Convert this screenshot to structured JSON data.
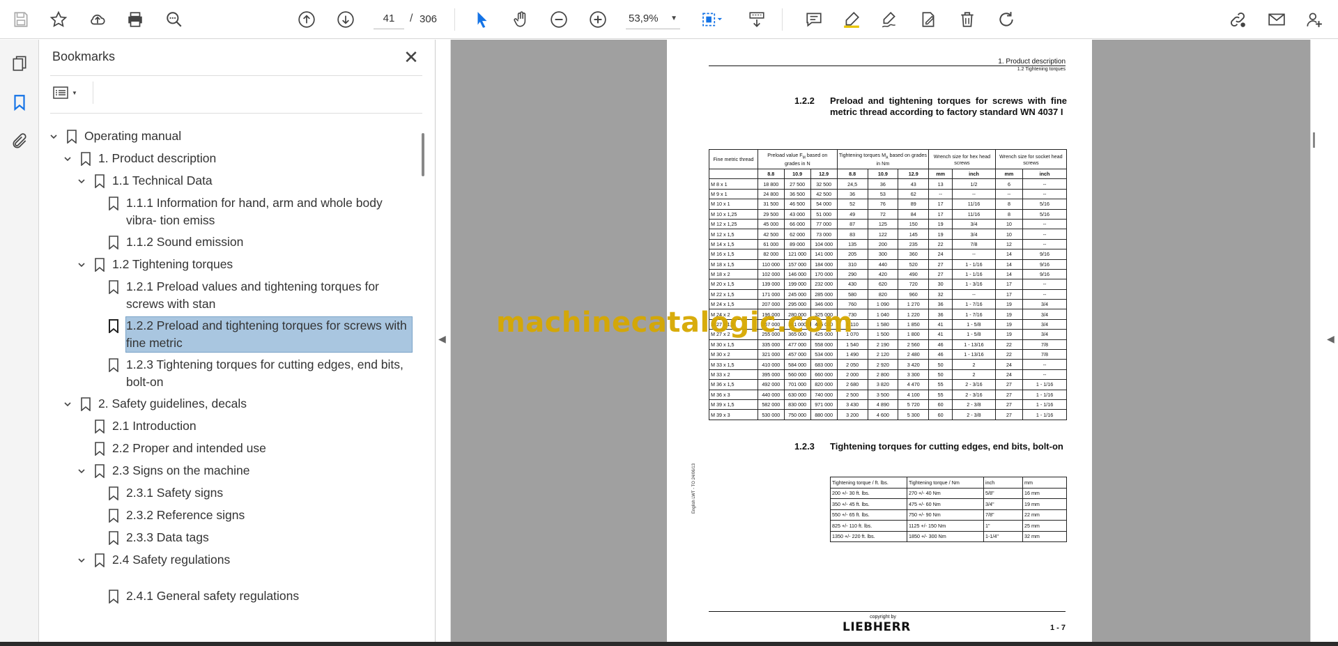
{
  "toolbar": {
    "page_current": "41",
    "page_separator": "/",
    "page_total": "306",
    "zoom": "53,9%"
  },
  "bookmarks_panel": {
    "title": "Bookmarks",
    "items": [
      {
        "label": "Operating manual",
        "expanded": true
      },
      {
        "label": "1. Product description",
        "expanded": true
      },
      {
        "label": "1.1 Technical Data",
        "expanded": true
      },
      {
        "label": "1.1.1 Information for hand, arm and whole body vibra- tion emiss"
      },
      {
        "label": "1.1.2 Sound emission"
      },
      {
        "label": "1.2 Tightening torques",
        "expanded": true
      },
      {
        "label": "1.2.1 Preload values and tightening torques for screws with stan"
      },
      {
        "label": "1.2.2 Preload and tightening torques for screws with fine metric",
        "selected": true
      },
      {
        "label": "1.2.3 Tightening torques for cutting edges, end bits, bolt-on"
      },
      {
        "label": "2. Safety guidelines, decals",
        "expanded": true
      },
      {
        "label": "2.1 Introduction"
      },
      {
        "label": "2.2 Proper and intended use"
      },
      {
        "label": "2.3 Signs on the machine",
        "expanded": true
      },
      {
        "label": "2.3.1 Safety signs"
      },
      {
        "label": "2.3.2 Reference signs"
      },
      {
        "label": "2.3.3 Data tags"
      },
      {
        "label": "2.4 Safety regulations",
        "expanded": true
      },
      {
        "label": "2.4.1 General safety regulations"
      }
    ]
  },
  "document": {
    "header_chapter": "1. Product description",
    "header_section": "1.2 Tightening torques",
    "section1_num": "1.2.2",
    "section1_title": "Preload and tightening torques for screws with fine metric thread according to factory standard WN 4037 I",
    "table1": {
      "headers": [
        "Fine metric thread",
        "Preload value F",
        "M",
        " based on grades in N",
        "Tightening torques M",
        "A",
        " based on grades in Nm",
        "Wrench size for hex head screws",
        "Wrench size for socket head screws"
      ],
      "subheaders": [
        "8.8",
        "10.9",
        "12.9",
        "8.8",
        "10.9",
        "12.9",
        "mm",
        "inch",
        "mm",
        "inch"
      ],
      "rows": [
        [
          "M 8 x 1",
          "18 800",
          "27 500",
          "32 500",
          "24,5",
          "36",
          "43",
          "13",
          "1/2",
          "6",
          "--"
        ],
        [
          "M 9 x 1",
          "24 800",
          "36 500",
          "42 500",
          "36",
          "53",
          "62",
          "--",
          "--",
          "--",
          "--"
        ],
        [
          "M 10 x 1",
          "31 500",
          "46 500",
          "54 000",
          "52",
          "76",
          "89",
          "17",
          "11/16",
          "8",
          "5/16"
        ],
        [
          "M 10 x 1,25",
          "29 500",
          "43 000",
          "51 000",
          "49",
          "72",
          "84",
          "17",
          "11/16",
          "8",
          "5/16"
        ],
        [
          "M 12 x 1,25",
          "45 000",
          "66 000",
          "77 000",
          "87",
          "125",
          "150",
          "19",
          "3/4",
          "10",
          "--"
        ],
        [
          "M 12 x 1,5",
          "42 500",
          "62 000",
          "73 000",
          "83",
          "122",
          "145",
          "19",
          "3/4",
          "10",
          "--"
        ],
        [
          "M 14 x 1,5",
          "61 000",
          "89 000",
          "104 000",
          "135",
          "200",
          "235",
          "22",
          "7/8",
          "12",
          "--"
        ],
        [
          "M 16 x 1,5",
          "82 000",
          "121 000",
          "141 000",
          "205",
          "300",
          "360",
          "24",
          "--",
          "14",
          "9/16"
        ],
        [
          "M 18 x 1,5",
          "110 000",
          "157 000",
          "184 000",
          "310",
          "440",
          "520",
          "27",
          "1 - 1/16",
          "14",
          "9/16"
        ],
        [
          "M 18 x 2",
          "102 000",
          "146 000",
          "170 000",
          "290",
          "420",
          "490",
          "27",
          "1 - 1/16",
          "14",
          "9/16"
        ],
        [
          "M 20 x 1,5",
          "139 000",
          "199 000",
          "232 000",
          "430",
          "620",
          "720",
          "30",
          "1 - 3/16",
          "17",
          "--"
        ],
        [
          "M 22 x 1,5",
          "171 000",
          "245 000",
          "285 000",
          "580",
          "820",
          "960",
          "32",
          "--",
          "17",
          "--"
        ],
        [
          "M 24 x 1,5",
          "207 000",
          "295 000",
          "346 000",
          "760",
          "1 090",
          "1 270",
          "36",
          "1 - 7/16",
          "19",
          "3/4"
        ],
        [
          "M 24 x 2",
          "196 000",
          "280 000",
          "325 000",
          "730",
          "1 040",
          "1 220",
          "36",
          "1 - 7/16",
          "19",
          "3/4"
        ],
        [
          "M 27 x 1,5",
          "267 000",
          "381 000",
          "445 000",
          "1 110",
          "1 580",
          "1 850",
          "41",
          "1 - 5/8",
          "19",
          "3/4"
        ],
        [
          "M 27 x 2",
          "255 000",
          "365 000",
          "425 000",
          "1 070",
          "1 500",
          "1 800",
          "41",
          "1 - 5/8",
          "19",
          "3/4"
        ],
        [
          "M 30 x 1,5",
          "335 000",
          "477 000",
          "558 000",
          "1 540",
          "2 190",
          "2 560",
          "46",
          "1 - 13/16",
          "22",
          "7/8"
        ],
        [
          "M 30 x 2",
          "321 000",
          "457 000",
          "534 000",
          "1 490",
          "2 120",
          "2 480",
          "46",
          "1 - 13/16",
          "22",
          "7/8"
        ],
        [
          "M 33 x 1,5",
          "410 000",
          "584 000",
          "683 000",
          "2 050",
          "2 920",
          "3 420",
          "50",
          "2",
          "24",
          "--"
        ],
        [
          "M 33 x 2",
          "395 000",
          "560 000",
          "660 000",
          "2 000",
          "2 800",
          "3 300",
          "50",
          "2",
          "24",
          "--"
        ],
        [
          "M 36 x 1,5",
          "492 000",
          "701 000",
          "820 000",
          "2 680",
          "3 820",
          "4 470",
          "55",
          "2 - 3/16",
          "27",
          "1 - 1/16"
        ],
        [
          "M 36 x 3",
          "440 000",
          "630 000",
          "740 000",
          "2 500",
          "3 500",
          "4 100",
          "55",
          "2 - 3/16",
          "27",
          "1 - 1/16"
        ],
        [
          "M 39 x 1,5",
          "582 000",
          "830 000",
          "971 000",
          "3 430",
          "4 890",
          "5 720",
          "60",
          "2 - 3/8",
          "27",
          "1 - 1/16"
        ],
        [
          "M 39 x 3",
          "530 000",
          "750 000",
          "880 000",
          "3 200",
          "4 600",
          "5 300",
          "60",
          "2 - 3/8",
          "27",
          "1 - 1/16"
        ]
      ]
    },
    "section2_num": "1.2.3",
    "section2_title": "Tightening torques for cutting edges, end bits, bolt-on",
    "table2": {
      "headers": [
        "Tightening torque / ft. lbs.",
        "Tightening torque / Nm",
        "inch",
        "mm"
      ],
      "rows": [
        [
          "200 +/- 30 ft. lbs.",
          "270 +/- 40 Nm",
          "5/8\"",
          "16 mm"
        ],
        [
          "350 +/- 45 ft. lbs.",
          "475 +/- 60 Nm",
          "3/4\"",
          "19 mm"
        ],
        [
          "550 +/- 65 ft. lbs.",
          "750 +/- 90 Nm",
          "7/8\"",
          "22 mm"
        ],
        [
          "825 +/- 110 ft. lbs.",
          "1125 +/- 150 Nm",
          "1\"",
          "25 mm"
        ],
        [
          "1350 +/- 220 ft. lbs.",
          "1850 +/- 300 Nm",
          "1-1/4\"",
          "32 mm"
        ]
      ]
    },
    "side_text": "English  LWT - TO 24/06/13",
    "copyright": "copyright by",
    "brand": "LIEBHERR",
    "page_number": "1 - 7"
  },
  "watermark": "machinecatalogic.com",
  "colors": {
    "selection": "#a9c6e0",
    "accent_blue": "#1473e6",
    "watermark": "#d6a800",
    "doc_background": "#a0a0a0"
  }
}
